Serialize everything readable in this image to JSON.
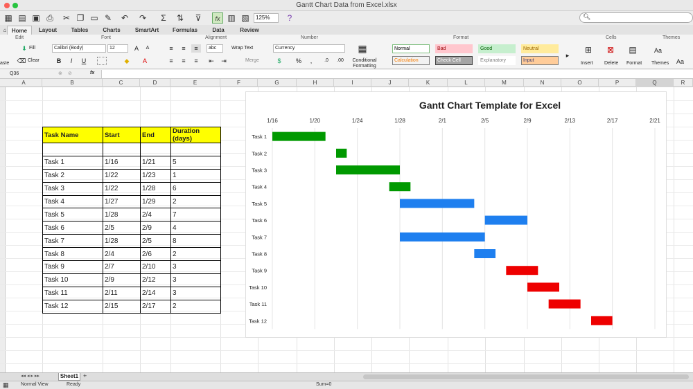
{
  "window": {
    "title": "Gantt Chart Data from Excel.xlsx",
    "zoom": "125%"
  },
  "ribbon_tabs": [
    {
      "label": "Home"
    },
    {
      "label": "Layout"
    },
    {
      "label": "Tables"
    },
    {
      "label": "Charts"
    },
    {
      "label": "SmartArt"
    },
    {
      "label": "Formulas"
    },
    {
      "label": "Data"
    },
    {
      "label": "Review"
    }
  ],
  "ribbon": {
    "groups": {
      "edit": "Edit",
      "font": "Font",
      "alignment": "Alignment",
      "number": "Number",
      "format": "Format",
      "cells": "Cells",
      "themes": "Themes"
    },
    "fill": "Fill",
    "clear": "Clear",
    "paste": "aste",
    "font_name": "Calibri (Body)",
    "font_size": "12",
    "wrap_text": "Wrap Text",
    "merge": "Merge",
    "abc": "abc",
    "number_format": "Currency",
    "conditional_formatting": "Conditional Formatting",
    "styles": [
      {
        "label": "Normal",
        "color": "#000000",
        "bg": "#ffffff",
        "border": "#7fbf7f"
      },
      {
        "label": "Bad",
        "color": "#9c0006",
        "bg": "#ffc7ce",
        "border": "#ffc7ce"
      },
      {
        "label": "Good",
        "color": "#006100",
        "bg": "#c6efce",
        "border": "#c6efce"
      },
      {
        "label": "Neutral",
        "color": "#9c6500",
        "bg": "#ffeb9c",
        "border": "#ffeb9c"
      },
      {
        "label": "Calculation",
        "color": "#fa7d00",
        "bg": "#f2f2f2",
        "border": "#7f7f7f"
      },
      {
        "label": "Check Cell",
        "color": "#ffffff",
        "bg": "#a5a5a5",
        "border": "#3f3f3f"
      },
      {
        "label": "Explanatory",
        "color": "#7f7f7f",
        "bg": "#ffffff",
        "border": "#ffffff"
      },
      {
        "label": "Input",
        "color": "#3f3f76",
        "bg": "#ffcc99",
        "border": "#7f7f7f"
      }
    ],
    "insert": "Insert",
    "delete": "Delete",
    "format_btn": "Format",
    "themes_btn": "Themes",
    "aa": "Aa"
  },
  "formula_bar": {
    "cell_ref": "Q36",
    "fx": "fx"
  },
  "columns": [
    "A",
    "B",
    "C",
    "D",
    "E",
    "F",
    "G",
    "H",
    "I",
    "J",
    "K",
    "L",
    "M",
    "N",
    "O",
    "P",
    "Q",
    "R"
  ],
  "table": {
    "headers": [
      "Task Name",
      "Start",
      "End",
      "Duration (days)"
    ],
    "rows": [
      [
        "",
        "",
        "",
        ""
      ],
      [
        "Task 1",
        "1/16",
        "1/21",
        "5"
      ],
      [
        "Task 2",
        "1/22",
        "1/23",
        "1"
      ],
      [
        "Task 3",
        "1/22",
        "1/28",
        "6"
      ],
      [
        "Task 4",
        "1/27",
        "1/29",
        "2"
      ],
      [
        "Task 5",
        "1/28",
        "2/4",
        "7"
      ],
      [
        "Task 6",
        "2/5",
        "2/9",
        "4"
      ],
      [
        "Task 7",
        "1/28",
        "2/5",
        "8"
      ],
      [
        "Task 8",
        "2/4",
        "2/6",
        "2"
      ],
      [
        "Task 9",
        "2/7",
        "2/10",
        "3"
      ],
      [
        "Task 10",
        "2/9",
        "2/12",
        "3"
      ],
      [
        "Task 11",
        "2/11",
        "2/14",
        "3"
      ],
      [
        "Task 12",
        "2/15",
        "2/17",
        "2"
      ]
    ]
  },
  "chart_data": {
    "type": "bar",
    "title": "Gantt Chart Template for Excel",
    "xlabel": "",
    "ylabel": "",
    "x_ticks": [
      "1/16",
      "1/20",
      "1/24",
      "1/28",
      "2/1",
      "2/5",
      "2/9",
      "2/13",
      "2/17",
      "2/21"
    ],
    "xlim": [
      "1/16",
      "2/21"
    ],
    "grid": true,
    "legend": "none",
    "tasks": [
      {
        "name": "Task 1",
        "start": "1/16",
        "end": "1/21",
        "color": "#009900"
      },
      {
        "name": "Task 2",
        "start": "1/22",
        "end": "1/23",
        "color": "#009900"
      },
      {
        "name": "Task 3",
        "start": "1/22",
        "end": "1/28",
        "color": "#009900"
      },
      {
        "name": "Task 4",
        "start": "1/27",
        "end": "1/29",
        "color": "#009900"
      },
      {
        "name": "Task 5",
        "start": "1/28",
        "end": "2/4",
        "color": "#1e7fef"
      },
      {
        "name": "Task 6",
        "start": "2/5",
        "end": "2/9",
        "color": "#1e7fef"
      },
      {
        "name": "Task 7",
        "start": "1/28",
        "end": "2/5",
        "color": "#1e7fef"
      },
      {
        "name": "Task 8",
        "start": "2/4",
        "end": "2/6",
        "color": "#1e7fef"
      },
      {
        "name": "Task 9",
        "start": "2/7",
        "end": "2/10",
        "color": "#ee0000"
      },
      {
        "name": "Task 10",
        "start": "2/9",
        "end": "2/12",
        "color": "#ee0000"
      },
      {
        "name": "Task 11",
        "start": "2/11",
        "end": "2/14",
        "color": "#ee0000"
      },
      {
        "name": "Task 12",
        "start": "2/15",
        "end": "2/17",
        "color": "#ee0000"
      }
    ]
  },
  "sheet_tab": "Sheet1",
  "status": {
    "view": "Normal View",
    "ready": "Ready",
    "sum": "Sum=0"
  }
}
